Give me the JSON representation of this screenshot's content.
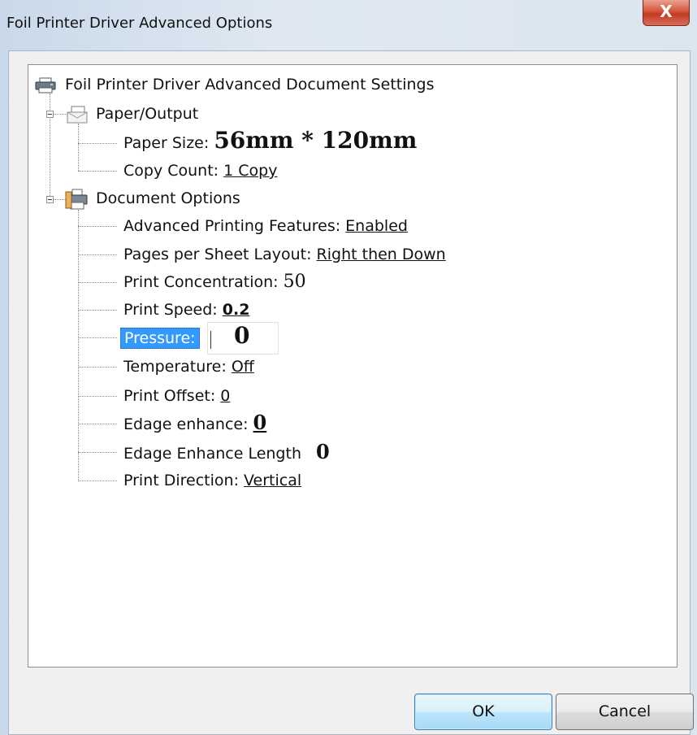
{
  "window": {
    "title": "Foil Printer Driver Advanced Options",
    "close_glyph": "X"
  },
  "tree": {
    "root_label": "Foil Printer Driver Advanced Document Settings",
    "paper_output": {
      "label": "Paper/Output",
      "paper_size": {
        "label": "Paper Size:",
        "value": "56mm * 120mm"
      },
      "copy_count": {
        "label": "Copy Count:",
        "value": "1 Copy"
      }
    },
    "document_options": {
      "label": "Document Options",
      "advanced_printing": {
        "label": "Advanced Printing Features:",
        "value": "Enabled"
      },
      "pages_per_sheet": {
        "label": "Pages per Sheet Layout:",
        "value": "Right then Down"
      },
      "print_concentration": {
        "label": "Print Concentration:",
        "value": "50"
      },
      "print_speed": {
        "label": "Print Speed:",
        "value": "0.2"
      },
      "pressure": {
        "label": "Pressure:",
        "value": "0"
      },
      "temperature": {
        "label": "Temperature:",
        "value": "Off"
      },
      "print_offset": {
        "label": "Print Offset:",
        "value": "0"
      },
      "edge_enhance": {
        "label": "Edage enhance:",
        "value": "0"
      },
      "edge_enhance_length": {
        "label": "Edage Enhance Length",
        "value": "0"
      },
      "print_direction": {
        "label": "Print Direction:",
        "value": "Vertical"
      }
    }
  },
  "buttons": {
    "ok": "OK",
    "cancel": "Cancel"
  },
  "colors": {
    "selection": "#3399ff",
    "close_button": "#c13b22",
    "ok_border": "#3c7fb1"
  }
}
